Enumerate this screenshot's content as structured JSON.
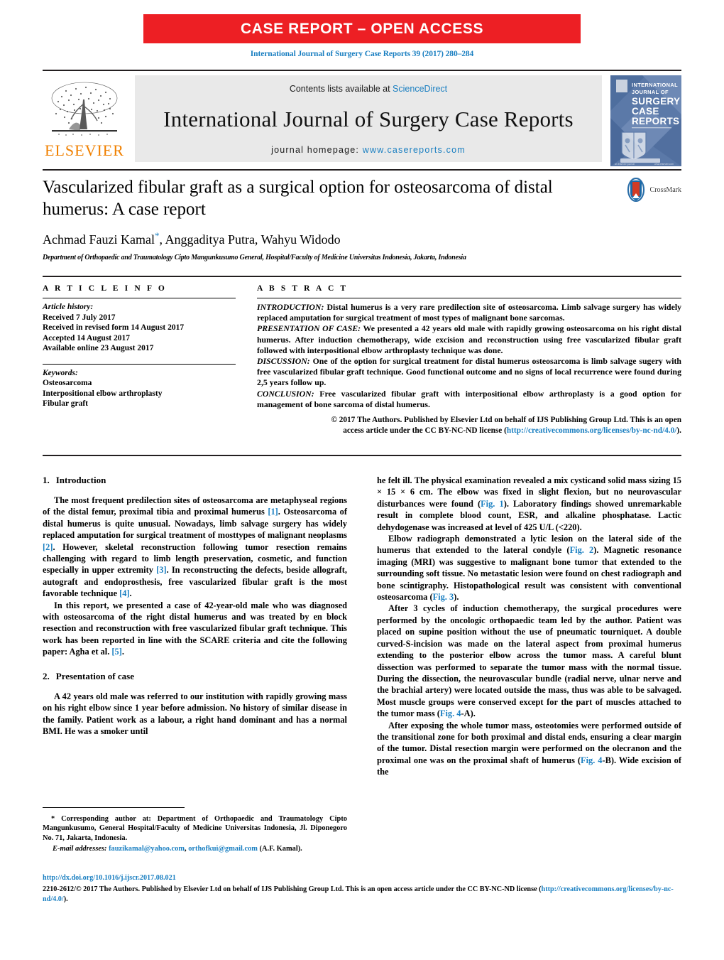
{
  "banner": {
    "text": "CASE REPORT – OPEN ACCESS",
    "color": "#ed1f24"
  },
  "citation": "International Journal of Surgery Case Reports 39 (2017) 280–284",
  "masthead": {
    "publisher": "ELSEVIER",
    "contents_prefix": "Contents lists available at ",
    "contents_link": "ScienceDirect",
    "journal_name": "International Journal of Surgery Case Reports",
    "homepage_label": "journal homepage: ",
    "homepage_url": "www.casereports.com",
    "cover": {
      "line1": "INTERNATIONAL",
      "line2": "JOURNAL OF",
      "line3": "SURGERY",
      "line4": "CASE",
      "line5": "REPORTS"
    }
  },
  "article": {
    "title": "Vascularized fibular graft as a surgical option for osteosarcoma of distal humerus: A case report",
    "authors": "Achmad Fauzi Kamal",
    "authors_rest": ", Anggaditya Putra, Wahyu Widodo",
    "corresponding_marker": "*",
    "affiliation": "Department of Orthopaedic and Traumatology Cipto Mangunkusumo General, Hospital/Faculty of Medicine Universitas Indonesia, Jakarta, Indonesia",
    "crossmark_label": "CrossMark"
  },
  "article_info": {
    "heading": "A R T I C L E   I N F O",
    "history_label": "Article history:",
    "history": [
      "Received 7 July 2017",
      "Received in revised form 14 August 2017",
      "Accepted 14 August 2017",
      "Available online 23 August 2017"
    ],
    "keywords_label": "Keywords:",
    "keywords": [
      "Osteosarcoma",
      "Interpositional elbow arthroplasty",
      "Fibular graft"
    ]
  },
  "abstract": {
    "heading": "A B S T R A C T",
    "sections": [
      {
        "label": "INTRODUCTION:",
        "text": " Distal humerus is a very rare predilection site of osteosarcoma. Limb salvage surgery has widely replaced amputation for surgical treatment of most types of malignant bone sarcomas."
      },
      {
        "label": "PRESENTATION OF CASE:",
        "text": " We presented a 42 years old male with rapidly growing osteosarcoma on his right distal humerus. After induction chemotherapy, wide excision and reconstruction using free vascularized fibular graft followed with interpositional elbow arthroplasty technique was done."
      },
      {
        "label": "DISCUSSION:",
        "text": " One of the option for surgical treatment for distal humerus osteosarcoma is limb salvage sugery with free vascularized fibular graft technique. Good functional outcome and no signs of local recurrence were found during 2,5 years follow up."
      },
      {
        "label": "CONCLUSION:",
        "text": " Free vascularized fibular graft with interpositional elbow arthroplasty is a good option for management of bone sarcoma of distal humerus."
      }
    ],
    "copyright_line1": "© 2017 The Authors. Published by Elsevier Ltd on behalf of IJS Publishing Group Ltd. This is an open",
    "copyright_line2_pre": "access article under the CC BY-NC-ND license (",
    "copyright_link": "http://creativecommons.org/licenses/by-nc-nd/4.0/",
    "copyright_line2_post": ")."
  },
  "body": {
    "left": {
      "section1_num": "1.",
      "section1_title": "Introduction",
      "p1_a": "The most frequent predilection sites of osteosarcoma are metaphyseal regions of the distal femur, proximal tibia and proximal humerus ",
      "ref1": "[1]",
      "p1_b": ". Osteosarcoma of distal humerus is quite unusual. Nowadays, limb salvage surgery has widely replaced amputation for surgical treatment of mosttypes of malignant neoplasms ",
      "ref2": "[2]",
      "p1_c": ". However, skeletal reconstruction following tumor resection remains challenging with regard to limb length preservation, cosmetic, and function especially in upper extremity ",
      "ref3": "[3]",
      "p1_d": ". In reconstructing the defects, beside allograft, autograft and endoprosthesis, free vascularized fibular graft is the most favorable technique ",
      "ref4": "[4]",
      "p1_e": ".",
      "p2_a": "In this report, we presented a case of 42-year-old male who was diagnosed with osteosarcoma of the right distal humerus and was treated by en block resection and reconstruction with free vascularized fibular graft technique. This work has been reported in line with the SCARE criteria and cite the following paper: Agha et al. ",
      "ref5": "[5]",
      "p2_b": ".",
      "section2_num": "2.",
      "section2_title": "Presentation of case",
      "p3": "A 42 years old male was referred to our institution with rapidly growing mass on his right elbow since 1 year before admission. No history of similar disease in the family. Patient work as a labour, a right hand dominant and has a normal BMI. He was a smoker until"
    },
    "right": {
      "p1_a": "he felt ill. The physical examination revealed a mix cysticand solid mass sizing 15 × 15 × 6 cm. The elbow was fixed in slight flexion, but no neurovascular disturbances were found (",
      "fig1": "Fig. 1",
      "p1_b": "). Laboratory findings showed unremarkable result in complete blood count, ESR, and alkaline phosphatase. Lactic dehydogenase was increased at level of 425 U/L (<220).",
      "p2_a": "Elbow radiograph demonstrated a lytic lesion on the lateral side of the humerus that extended to the lateral condyle (",
      "fig2": "Fig. 2",
      "p2_b": "). Magnetic resonance imaging (MRI) was suggestive to malignant bone tumor that extended to the surrounding soft tissue. No metastatic lesion were found on chest radiograph and bone scintigraphy. Histopathological result was consistent with conventional osteosarcoma (",
      "fig3": "Fig. 3",
      "p2_c": ").",
      "p3_a": "After 3 cycles of induction chemotherapy, the surgical procedures were performed by the oncologic orthopaedic team led by the author. Patient was placed on supine position without the use of pneumatic tourniquet. A double curved-S-incision was made on the lateral aspect from proximal humerus extending to the posterior elbow across the tumor mass. A careful blunt dissection was performed to separate the tumor mass with the normal tissue. During the dissection, the neurovascular bundle (radial nerve, ulnar nerve and the brachial artery) were located outside the mass, thus was able to be salvaged. Most muscle groups were conserved except for the part of muscles attached to the tumor mass (",
      "fig4a": "Fig. 4",
      "p3_b": "-A).",
      "p4_a": "After exposing the whole tumor mass, osteotomies were performed outside of the transitional zone for both proximal and distal ends, ensuring a clear margin of the tumor. Distal resection margin were performed on the olecranon and the proximal one was on the proximal shaft of humerus (",
      "fig4b": "Fig. 4",
      "p4_b": "-B). Wide excision of the"
    }
  },
  "footnote": {
    "star": "*",
    "text": " Corresponding author at: Department of Orthopaedic and Traumatology Cipto Mangunkusumo, General Hospital/Faculty of Medicine Universitas Indonesia, Jl. Diponegoro No. 71, Jakarta, Indonesia.",
    "email_label": "E-mail addresses:",
    "email1": "fauzikamal@yahoo.com",
    "email_sep": ", ",
    "email2": "orthofkui@gmail.com",
    "email_suffix": " (A.F. Kamal)."
  },
  "bottom": {
    "doi": "http://dx.doi.org/10.1016/j.ijscr.2017.08.021",
    "line_pre": "2210-2612/© 2017 The Authors. Published by Elsevier Ltd on behalf of IJS Publishing Group Ltd. This is an open access article under the CC BY-NC-ND license (",
    "link": "http://creativecommons.org/licenses/by-nc-nd/4.0/",
    "line_post": ")."
  },
  "colors": {
    "link": "#1a7fc1",
    "banner_red": "#ed1f24",
    "elsevier_orange": "#f08000"
  }
}
